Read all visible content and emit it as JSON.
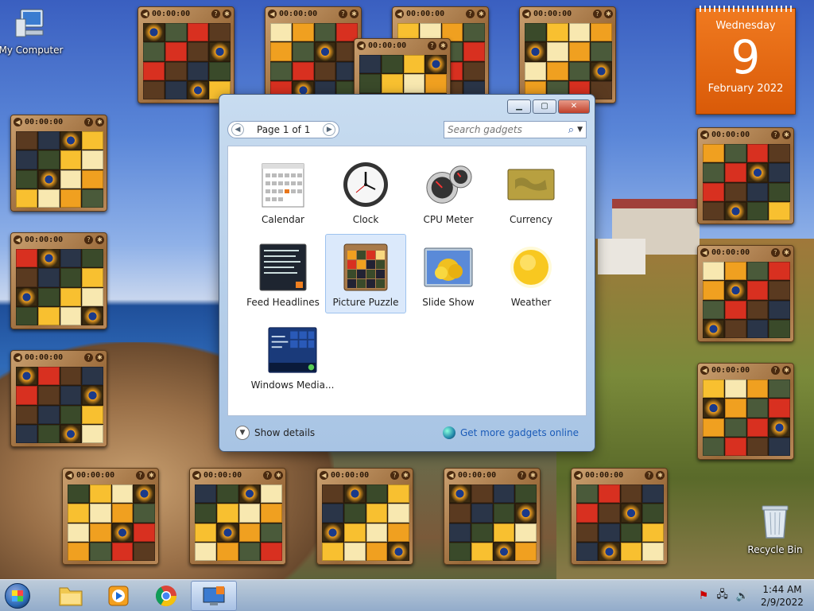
{
  "desktop": {
    "icons": [
      {
        "label": "My Computer"
      },
      {
        "label": "Recycle Bin"
      }
    ]
  },
  "gallery": {
    "pager": "Page 1 of 1",
    "search_placeholder": "Search gadgets",
    "gadgets": [
      {
        "label": "Calendar"
      },
      {
        "label": "Clock"
      },
      {
        "label": "CPU Meter"
      },
      {
        "label": "Currency"
      },
      {
        "label": "Feed Headlines"
      },
      {
        "label": "Picture Puzzle"
      },
      {
        "label": "Slide Show"
      },
      {
        "label": "Weather"
      },
      {
        "label": "Windows Media..."
      }
    ],
    "show_details": "Show details",
    "get_more": "Get more gadgets online"
  },
  "puzzle_timer": "00:00:00",
  "calendar_gadget": {
    "weekday": "Wednesday",
    "day": "9",
    "month_year": "February 2022"
  },
  "taskbar": {
    "time": "1:44 AM",
    "date": "2/9/2022"
  }
}
